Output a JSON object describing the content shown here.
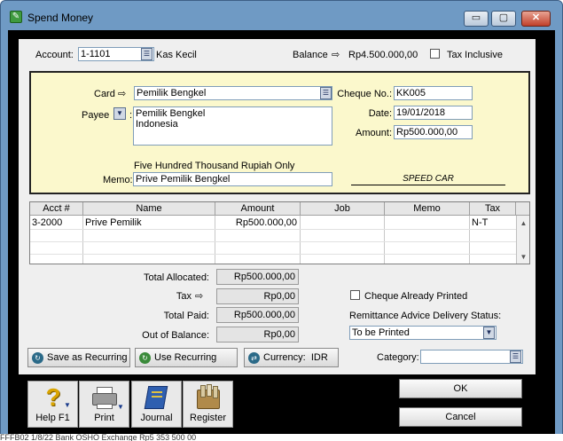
{
  "window": {
    "title": "Spend Money",
    "controls": {
      "minimize": "▭",
      "maximize": "▢",
      "close": "✕"
    }
  },
  "header": {
    "account_label": "Account:",
    "account_number": "1-1101",
    "account_name": "Kas Kecil",
    "balance_label": "Balance",
    "balance_value": "Rp4.500.000,00",
    "tax_inclusive_label": "Tax Inclusive",
    "tax_inclusive_checked": false
  },
  "cheque": {
    "card_label": "Card",
    "card_value": "Pemilik Bengkel",
    "payee_label": "Payee",
    "payee_line1": "Pemilik Bengkel",
    "payee_line2": "Indonesia",
    "amount_in_words": "Five Hundred Thousand Rupiah Only",
    "memo_label": "Memo:",
    "memo_value": "Prive Pemilik Bengkel",
    "cheque_no_label": "Cheque No.:",
    "cheque_no_value": "KK005",
    "date_label": "Date:",
    "date_value": "19/01/2018",
    "amount_label": "Amount:",
    "amount_value": "Rp500.000,00",
    "signature_text": "SPEED CAR"
  },
  "grid": {
    "columns": [
      "Acct #",
      "Name",
      "Amount",
      "Job",
      "Memo",
      "Tax"
    ],
    "rows": [
      {
        "acct": "3-2000",
        "name": "Prive Pemilik",
        "amount": "Rp500.000,00",
        "job": "",
        "memo": "",
        "tax": "N-T"
      }
    ]
  },
  "totals": {
    "total_allocated_label": "Total Allocated:",
    "total_allocated_value": "Rp500.000,00",
    "tax_label": "Tax",
    "tax_value": "Rp0,00",
    "total_paid_label": "Total Paid:",
    "total_paid_value": "Rp500.000,00",
    "out_of_balance_label": "Out of Balance:",
    "out_of_balance_value": "Rp0,00"
  },
  "options": {
    "cheque_printed_label": "Cheque Already Printed",
    "cheque_printed_checked": false,
    "remittance_label": "Remittance Advice Delivery Status:",
    "remittance_value": "To be Printed"
  },
  "recurring": {
    "save_label": "Save as Recurring",
    "use_label": "Use Recurring",
    "currency_label": "Currency:",
    "currency_value": "IDR",
    "category_label": "Category:",
    "category_value": ""
  },
  "toolbar": {
    "help_label": "Help F1",
    "print_label": "Print",
    "journal_label": "Journal",
    "register_label": "Register"
  },
  "actions": {
    "ok_label": "OK",
    "cancel_label": "Cancel"
  },
  "background_text": "FFFB02   1/8/22   Bank OSHO Exchange                    Rp5 353 500 00"
}
